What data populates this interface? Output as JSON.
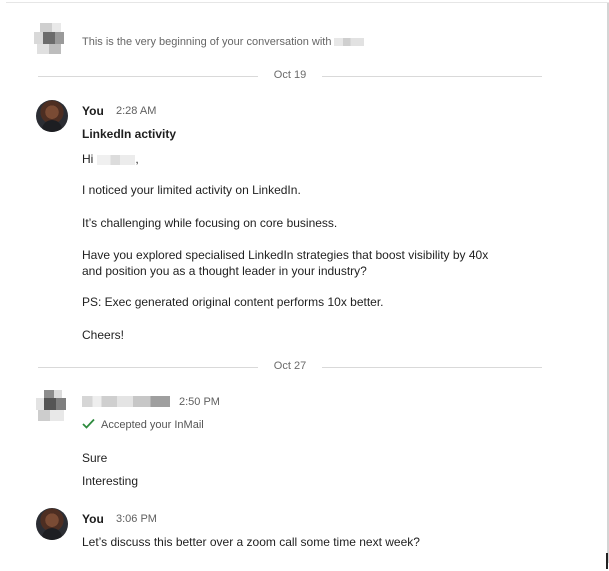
{
  "conversation": {
    "beginning_text": "This is the very beginning of your conversation with",
    "divider_1": "Oct 19",
    "divider_2": "Oct 27"
  },
  "messages": [
    {
      "sender": "You",
      "time": "2:28 AM",
      "subject": "LinkedIn activity",
      "greeting": "Hi",
      "greeting_suffix": ",",
      "lines": [
        "I noticed your limited activity on LinkedIn.",
        "It’s challenging while focusing on core business.",
        "Have you explored specialised LinkedIn strategies that boost visibility by 40x",
        "and position you as a thought leader in your industry?",
        "PS: Exec generated original content performs 10x better.",
        "Cheers!"
      ]
    },
    {
      "time": "2:50 PM",
      "status": "Accepted your InMail",
      "lines": [
        "Sure",
        "Interesting"
      ]
    },
    {
      "sender": "You",
      "time": "3:06 PM",
      "lines": [
        "Let’s discuss this better over a zoom call some time next week?"
      ]
    }
  ],
  "icons": {
    "accepted": "check-icon",
    "accent_color": "#2e8b3e"
  }
}
